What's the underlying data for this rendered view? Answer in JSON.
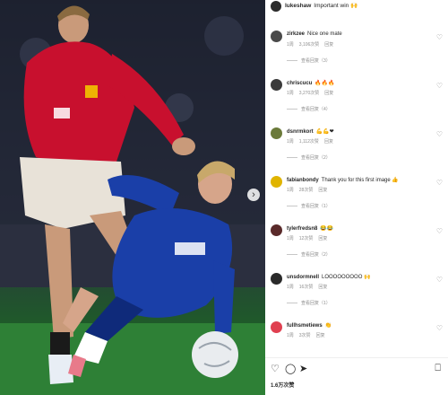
{
  "post": {
    "author": "lukeshaw",
    "caption": "Important win 🙌"
  },
  "comments": [
    {
      "user": "zirkzee",
      "text": "Nice one mate",
      "time": "1周",
      "likes": "3,106次赞",
      "reply": "回复",
      "replies": "查看回复（3）",
      "avatar_color": "#4a4a4a"
    },
    {
      "user": "chriscucu",
      "text": "🔥🔥🔥",
      "time": "1周",
      "likes": "3,270次赞",
      "reply": "回复",
      "replies": "查看回复（4）",
      "avatar_color": "#3b3b3b"
    },
    {
      "user": "dsnrmkort",
      "text": "💪💪❤",
      "time": "1周",
      "likes": "1,112次赞",
      "reply": "回复",
      "replies": "查看回复（2）",
      "avatar_color": "#6b7a3a"
    },
    {
      "user": "fabianbondy",
      "text": "Thank you for this first image 👍",
      "time": "1周",
      "likes": "28次赞",
      "reply": "回复",
      "replies": "查看回复（1）",
      "avatar_color": "#e0b400"
    },
    {
      "user": "tylerfredsn8",
      "text": "😂😂",
      "time": "1周",
      "likes": "12次赞",
      "reply": "回复",
      "replies": "查看回复（2）",
      "avatar_color": "#5a2a2a"
    },
    {
      "user": "unsdormnell",
      "text": "LOOOOOOOOO 🙌",
      "time": "1周",
      "likes": "16次赞",
      "reply": "回复",
      "replies": "查看回复（1）",
      "avatar_color": "#2a2a2a"
    },
    {
      "user": "fullhsmetiews",
      "text": "👏",
      "time": "1周",
      "likes": "3次赞",
      "reply": "回复",
      "replies": "",
      "avatar_color": "#e04050"
    }
  ],
  "actions": {
    "like_icon": "heart-outline-icon",
    "comment_icon": "comment-bubble-icon",
    "share_icon": "paper-plane-icon",
    "save_icon": "bookmark-icon",
    "like_glyph": "♡",
    "comment_glyph": "◯",
    "share_glyph": "➤",
    "save_glyph": "⎕",
    "heart_glyph": "♡"
  },
  "likes_summary": "1.6万次赞",
  "carousel_arrow": "›",
  "colors": {
    "red_kit": "#c8102e",
    "blue_kit": "#1a3fa8",
    "pitch": "#2c7a34"
  }
}
